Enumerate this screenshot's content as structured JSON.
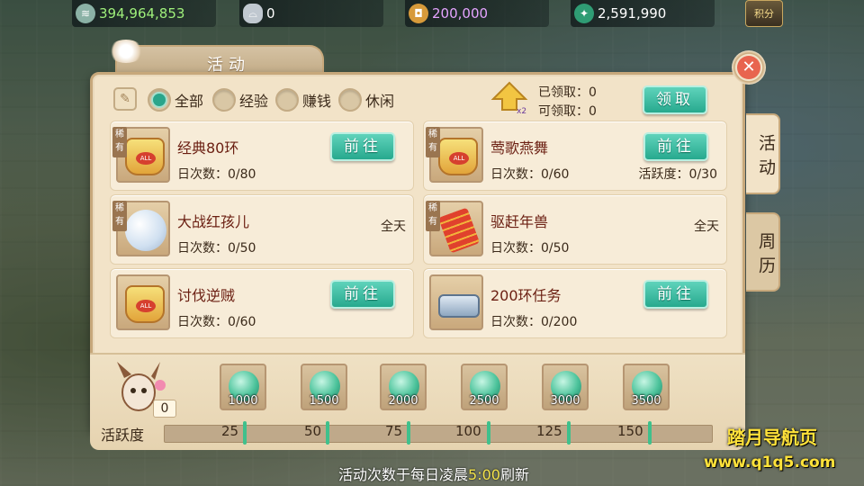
{
  "currency": {
    "silver": "394,964,853",
    "ingot": "0",
    "coin": "200,000",
    "jade": "2,591,990",
    "points_label": "积分"
  },
  "panel": {
    "title": "活动",
    "filters": [
      {
        "label": "全部",
        "selected": true
      },
      {
        "label": "经验",
        "selected": false
      },
      {
        "label": "赚钱",
        "selected": false
      },
      {
        "label": "休闲",
        "selected": false
      }
    ],
    "claimed": "已领取：0",
    "claimable": "可领取：0",
    "claim_button": "领取",
    "double_badge": "x2"
  },
  "side_tabs": [
    "活动",
    "周历"
  ],
  "activities": [
    {
      "name": "经典80环",
      "rare": "稀有",
      "count": "日次数：0/80",
      "button": "前往"
    },
    {
      "name": "莺歌燕舞",
      "rare": "稀有",
      "count": "日次数：0/60",
      "activity": "活跃度：0/30",
      "button": "前往"
    },
    {
      "name": "大战红孩儿",
      "rare": "稀有",
      "count": "日次数：0/50",
      "time": "全天"
    },
    {
      "name": "驱赶年兽",
      "rare": "稀有",
      "count": "日次数：0/50",
      "time": "全天"
    },
    {
      "name": "讨伐逆贼",
      "count": "日次数：0/60",
      "button": "前往"
    },
    {
      "name": "200环任务",
      "count": "日次数：0/200",
      "button": "前往"
    }
  ],
  "activity_score": "0",
  "rewards": [
    "1000",
    "1500",
    "2000",
    "2500",
    "3000",
    "3500"
  ],
  "activity_bar": {
    "label": "活跃度",
    "ticks": [
      "25",
      "50",
      "75",
      "100",
      "125",
      "150"
    ],
    "progress": 0
  },
  "refresh_note": {
    "prefix": "活动次数于每日凌晨",
    "time": "5:00",
    "suffix": "刷新"
  },
  "watermark": {
    "line1": "踏月导航页",
    "line2": "www.q1q5.com"
  }
}
